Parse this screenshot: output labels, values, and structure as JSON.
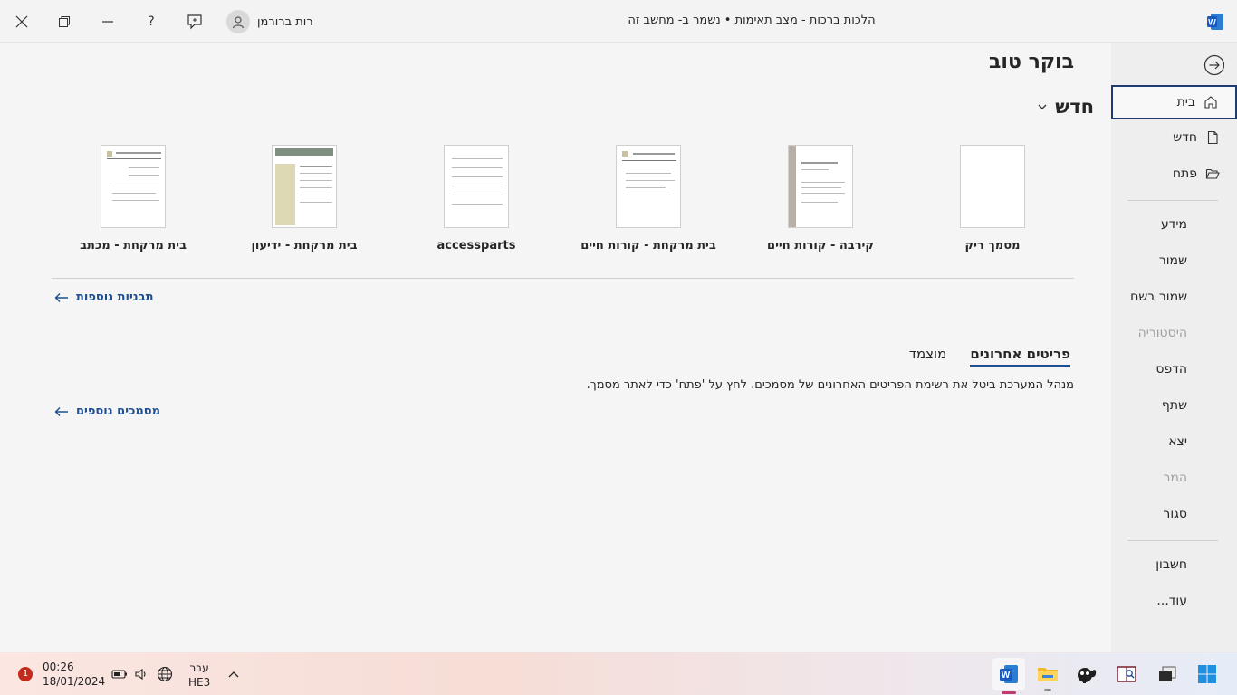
{
  "titlebar": {
    "doc_title": "הלכות ברכות  -  מצב תאימות • נשמר ב- מחשב זה",
    "user_name": "רות  ברורמן",
    "help_label": "?"
  },
  "sidebar": {
    "items": [
      {
        "label": "בית",
        "icon": "home-icon"
      },
      {
        "label": "חדש",
        "icon": "new-file-icon"
      },
      {
        "label": "פתח",
        "icon": "folder-open-icon"
      },
      {
        "label": "מידע"
      },
      {
        "label": "שמור"
      },
      {
        "label": "שמור בשם"
      },
      {
        "label": "היסטוריה"
      },
      {
        "label": "הדפס"
      },
      {
        "label": "שתף"
      },
      {
        "label": "יצא"
      },
      {
        "label": "המר"
      },
      {
        "label": "סגור"
      },
      {
        "label": "חשבון"
      },
      {
        "label": "עוד..."
      }
    ]
  },
  "main": {
    "greeting": "בוקר טוב",
    "new_section_title": "חדש",
    "templates": [
      {
        "label": "מסמך ריק"
      },
      {
        "label": "קירבה - קורות חיים"
      },
      {
        "label": "בית מרקחת - קורות חיים"
      },
      {
        "label": "accessparts"
      },
      {
        "label": "בית מרקחת - ידיעון"
      },
      {
        "label": "בית מרקחת - מכתב"
      }
    ],
    "more_templates_link": "תבניות נוספות",
    "tabs": [
      {
        "label": "פריטים אחרונים",
        "selected": true
      },
      {
        "label": "מוצמד",
        "selected": false
      }
    ],
    "recent_info": "מנהל המערכת ביטל את רשימת הפריטים האחרונים של מסמכים. לחץ על 'פתח' כדי לאתר מסמך.",
    "more_documents_link": "מסמכים נוספים"
  },
  "taskbar": {
    "time": "00:26",
    "date": "18/01/2024",
    "notification_count": "1",
    "lang_line1": "עבר",
    "lang_line2": "HE3"
  },
  "colors": {
    "accent": "#1f4e8f",
    "active_border": "#1f3b72",
    "word_blue": "#185abd"
  }
}
